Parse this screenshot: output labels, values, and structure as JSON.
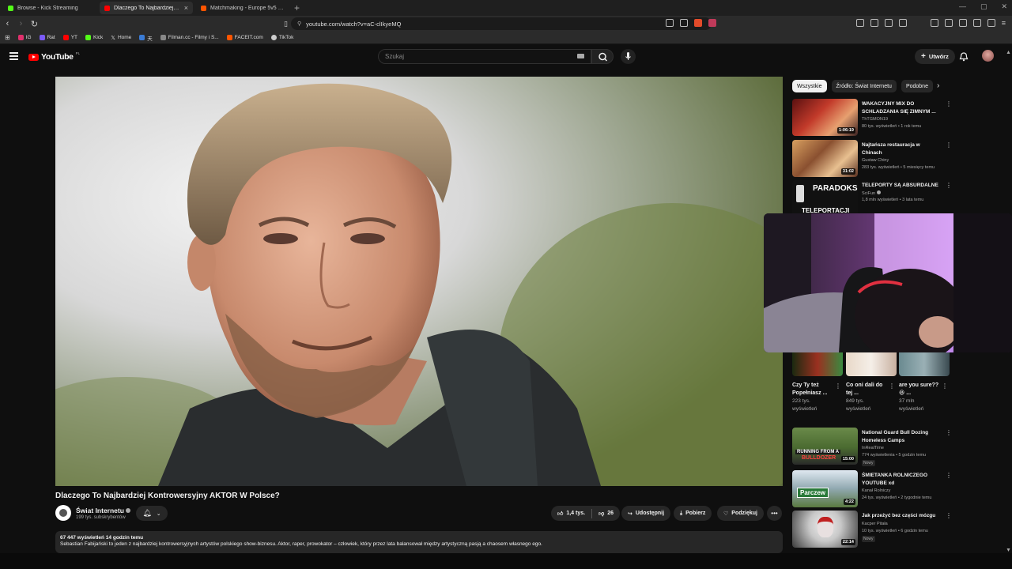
{
  "browser": {
    "tabs": [
      {
        "label": "Browse - Kick Streaming",
        "color": "#53fc18",
        "active": false
      },
      {
        "label": "Dlaczego To Najbardziej Kont",
        "color": "#ff0000",
        "active": true
      },
      {
        "label": "Matchmaking - Europe 5v5 Queue -",
        "color": "#ff5500",
        "active": false
      }
    ],
    "url": "youtube.com/watch?v=aC-clIkyeMQ",
    "bookmarks": [
      {
        "label": "IG",
        "color": "#e1306c"
      },
      {
        "label": "Rat",
        "color": "#7a5af8"
      },
      {
        "label": "YT",
        "color": "#ff0000"
      },
      {
        "label": "Kick",
        "color": "#53fc18"
      },
      {
        "label": "Home",
        "color": "#ffffff"
      },
      {
        "label": "天",
        "color": "#3a7bd5"
      },
      {
        "label": "Filman.cc - Filmy i S...",
        "color": "#888888"
      },
      {
        "label": "FACEIT.com",
        "color": "#ff5500"
      },
      {
        "label": "TikTok",
        "color": "#cccccc"
      }
    ]
  },
  "header": {
    "logo": "YouTube",
    "country": "PL",
    "search_placeholder": "Szukaj",
    "create_label": "Utwórz"
  },
  "video": {
    "title": "Dlaczego To Najbardziej Kontrowersyjny AKTOR W Polsce?",
    "channel": "Świat Internetu",
    "subscribers": "199 tys. subskrybentów",
    "likes": "1,4 tys.",
    "dislikes": "26",
    "share": "Udostępnij",
    "download": "Pobierz",
    "thanks": "Podziękuj",
    "meta": "67 447 wyświetleń  14 godzin temu",
    "description": "Sebastian Fabijański to jeden z najbardziej kontrowersyjnych artystów polskiego show-biznesu. Aktor, raper, prowokator – człowiek, który przez lata balansował między artystyczną pasją a chaosem własnego ego."
  },
  "sidebar": {
    "chips": [
      "Wszystkie",
      "Źródło: Świat Internetu",
      "Podobne"
    ],
    "items": [
      {
        "title": "WAKACYJNY MIX DO SCHLADZANIA SIĘ ZIMNYM ...",
        "channel": "ThTGMON19",
        "meta": "80 tys. wyświetleń • 1 rok temu",
        "duration": "1:06:19",
        "new": ""
      },
      {
        "title": "Najtańsza restauracja w Chinach",
        "channel": "Gustaw Chiny",
        "meta": "283 tys. wyświetleń • 5 miesięcy temu",
        "duration": "31:02",
        "new": ""
      },
      {
        "title": "TELEPORTY SĄ ABSURDALNE",
        "channel": "SciFun",
        "meta": "1,8 mln wyświetleń • 3 lata temu",
        "duration": "",
        "new": "",
        "thumb_text": "PARADOKS",
        "thumb_text2": "TELEPORTACJI"
      },
      {
        "title": "National Guard Bull Dozing Homeless Camps",
        "channel": "InRealTime",
        "meta": "774 wyświetlenia • 5 godzin temu",
        "duration": "15:00",
        "new": "Nowy",
        "thumb_text": "RUNNING FROM A",
        "thumb_text2": "BULLDOZER"
      },
      {
        "title": "ŚMIETANKA ROLNICZEGO YOUTUBE xd",
        "channel": "Kanał Rolniczy",
        "meta": "24 tys. wyświetleń • 2 tygodnie temu",
        "duration": "4:22",
        "new": "",
        "thumb_text": "Parczew"
      },
      {
        "title": "Jak przeżyć bez części mózgu",
        "channel": "Kacper Pitała",
        "meta": "10 tys. wyświetleń • 6 godzin temu",
        "duration": "22:14",
        "new": "Nowy"
      }
    ],
    "shorts": [
      {
        "title": "Czy Ty też Popełniasz ...",
        "views": "223 tys.",
        "views2": "wyświetleń"
      },
      {
        "title": "Co oni dali do tej ...",
        "views": "849 tys.",
        "views2": "wyświetleń"
      },
      {
        "title": "are you sure?? 😆 ...",
        "views": "37 mln",
        "views2": "wyświetleń"
      }
    ]
  },
  "colors": {
    "accent": "#ff0000",
    "background": "#0f0f0f",
    "surface": "#272727"
  }
}
